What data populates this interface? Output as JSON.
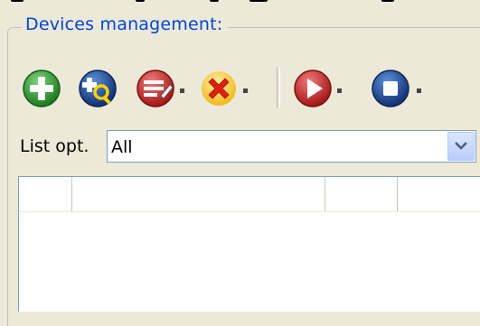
{
  "group": {
    "title": "Devices management:"
  },
  "toolbar": {
    "buttons": [
      {
        "name": "add-device-button",
        "icon": "add-plus-icon",
        "color": "#2e8b2e",
        "has_dropdown": false
      },
      {
        "name": "search-device-button",
        "icon": "search-add-icon",
        "color": "#1f4f9a",
        "has_dropdown": false
      },
      {
        "name": "edit-device-button",
        "icon": "edit-list-icon",
        "color": "#d23030",
        "has_dropdown": true
      },
      {
        "name": "delete-device-button",
        "icon": "delete-x-icon",
        "color": "#e03010",
        "has_dropdown": true
      },
      {
        "name": "start-button",
        "icon": "play-icon",
        "color": "#d23030",
        "has_dropdown": true
      },
      {
        "name": "stop-button",
        "icon": "stop-icon",
        "color": "#1f3f8f",
        "has_dropdown": true
      }
    ]
  },
  "list_options": {
    "label": "List opt.",
    "selected": "All"
  },
  "table": {
    "columns": [
      "",
      "",
      "",
      ""
    ],
    "rows": []
  }
}
